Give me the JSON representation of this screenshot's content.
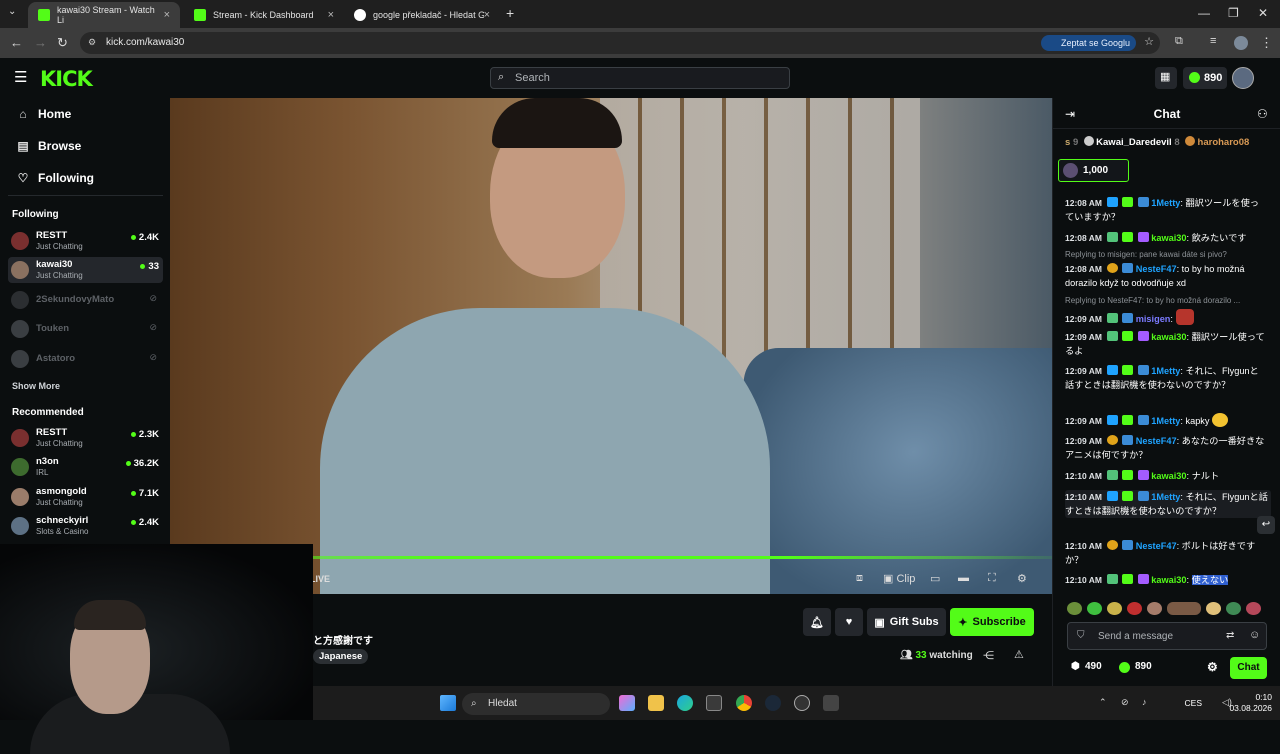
{
  "browser": {
    "tabs": [
      {
        "title": "kawai30 Stream - Watch Li",
        "active": true
      },
      {
        "title": "Stream - Kick Dashboard",
        "active": false
      },
      {
        "title": "google překladač - Hledat Goo",
        "active": false
      }
    ],
    "url": "kick.com/kawai30",
    "ask_google": "Zeptat se Googlu"
  },
  "header": {
    "logo": "KICK",
    "search_placeholder": "Search",
    "points": "890"
  },
  "sidebar": {
    "nav": [
      {
        "label": "Home",
        "icon": "home-icon"
      },
      {
        "label": "Browse",
        "icon": "browse-icon"
      },
      {
        "label": "Following",
        "icon": "heart-icon"
      }
    ],
    "following_heading": "Following",
    "following": [
      {
        "name": "RESTT",
        "category": "Just Chatting",
        "viewers": "2.4K",
        "live": true
      },
      {
        "name": "kawai30",
        "category": "Just Chatting",
        "viewers": "33",
        "live": true
      },
      {
        "name": "2SekundovyMato",
        "category": "",
        "viewers": "",
        "live": false
      },
      {
        "name": "Touken",
        "category": "",
        "viewers": "",
        "live": false
      },
      {
        "name": "Astatoro",
        "category": "",
        "viewers": "",
        "live": false
      }
    ],
    "show_more": "Show More",
    "recommended_heading": "Recommended",
    "recommended": [
      {
        "name": "RESTT",
        "category": "Just Chatting",
        "viewers": "2.3K"
      },
      {
        "name": "n3on",
        "category": "IRL",
        "viewers": "36.2K"
      },
      {
        "name": "asmongold",
        "category": "Just Chatting",
        "viewers": "7.1K"
      },
      {
        "name": "schneckyirl",
        "category": "Slots & Casino",
        "viewers": "2.4K"
      }
    ]
  },
  "player": {
    "live_label": "LIVE",
    "clip_label": "Clip"
  },
  "stream_info": {
    "title": "と方感謝です",
    "tag": "Japanese",
    "gift_subs": "Gift Subs",
    "subscribe": "Subscribe",
    "watching_count": "33",
    "watching_label": "watching"
  },
  "chat": {
    "title": "Chat",
    "leaderboard": [
      {
        "prefix": "s",
        "rank": "9"
      },
      {
        "name": "Kawai_Daredevil",
        "rank": "8"
      },
      {
        "name": "haroharo08"
      }
    ],
    "pinned_amount": "1,000",
    "messages": [
      {
        "time": "12:08 AM",
        "user": "1Metty",
        "color": "#1fa3ff",
        "text": "翻訳ツールを使っていますか？",
        "reply": ""
      },
      {
        "time": "12:08 AM",
        "user": "kawai30",
        "color": "#53fc18",
        "text": "飲みたいです",
        "reply": ""
      },
      {
        "time": "12:08 AM",
        "user": "NesteF47",
        "color": "#1fa3ff",
        "text": "to by ho možná dorazilo když to odvodňuje xd",
        "reply": "Replying to misigen: pane kawai dáte si pivo?"
      },
      {
        "time": "12:09 AM",
        "user": "misigen",
        "color": "#7b7bff",
        "text": "",
        "reply": "Replying to NesteF47: to by ho možná dorazilo ..."
      },
      {
        "time": "12:09 AM",
        "user": "kawai30",
        "color": "#53fc18",
        "text": "翻訳ツール使ってるよ",
        "reply": ""
      },
      {
        "time": "12:09 AM",
        "user": "1Metty",
        "color": "#1fa3ff",
        "text": "それに、Flygunと話すときは翻訳機を使わないのですか？",
        "reply": ""
      },
      {
        "time": "12:09 AM",
        "user": "1Metty",
        "color": "#1fa3ff",
        "text": "kapky",
        "reply": ""
      },
      {
        "time": "12:09 AM",
        "user": "NesteF47",
        "color": "#1fa3ff",
        "text": "あなたの一番好きなアニメは何ですか？",
        "reply": ""
      },
      {
        "time": "12:10 AM",
        "user": "kawai30",
        "color": "#53fc18",
        "text": "ナルト",
        "reply": ""
      },
      {
        "time": "12:10 AM",
        "user": "1Metty",
        "color": "#1fa3ff",
        "text": "それに、Flygunと話すときは翻訳機を使わないのですか？",
        "reply": ""
      },
      {
        "time": "12:10 AM",
        "user": "NesteF47",
        "color": "#1fa3ff",
        "text": "ボルトは好きですか？",
        "reply": ""
      },
      {
        "time": "12:10 AM",
        "user": "kawai30",
        "color": "#53fc18",
        "text": "使えない",
        "reply": ""
      }
    ],
    "input_placeholder": "Send a message",
    "footer_points_a": "490",
    "footer_points_b": "890",
    "send_button": "Chat"
  },
  "taskbar": {
    "search": "Hledat",
    "lang": "CES",
    "time": "0:10",
    "date": "03.08.2026"
  },
  "colors": {
    "accent": "#53fc18",
    "background": "#0b0e0f"
  }
}
